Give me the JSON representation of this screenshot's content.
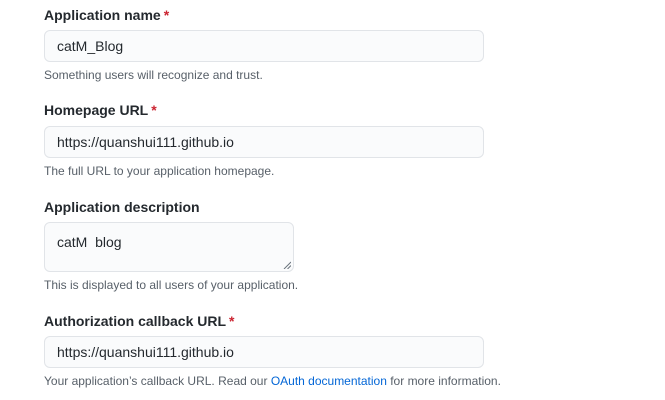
{
  "form": {
    "app_name": {
      "label": "Application name",
      "required_mark": "*",
      "value": "catM_Blog",
      "note": "Something users will recognize and trust."
    },
    "homepage_url": {
      "label": "Homepage URL",
      "required_mark": "*",
      "value": "https://quanshui111.github.io",
      "note": "The full URL to your application homepage."
    },
    "description": {
      "label": "Application description",
      "value": "catM  blog",
      "note": "This is displayed to all users of your application."
    },
    "callback_url": {
      "label": "Authorization callback URL",
      "required_mark": "*",
      "value": "https://quanshui111.github.io",
      "note_before": "Your application’s callback URL. Read our ",
      "note_link": "OAuth documentation",
      "note_after": " for more information."
    }
  },
  "colors": {
    "required": "#cb2431",
    "link": "#0366d6",
    "note_text": "#586069",
    "field_border": "#e1e4e8",
    "field_bg": "#fafbfc"
  }
}
